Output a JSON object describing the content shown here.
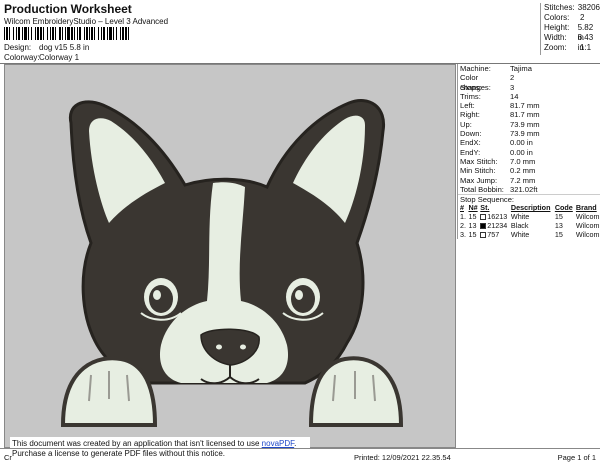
{
  "header": {
    "title": "Production Worksheet",
    "subtitle": "Wilcom EmbroideryStudio – Level 3 Advanced",
    "design_label": "Design:",
    "design_value": "dog v15 5.8 in",
    "colorway_label": "Colorway:",
    "colorway_value": "Colorway 1"
  },
  "summary": [
    {
      "label": "Stitches:",
      "value": "38206"
    },
    {
      "label": "Colors:",
      "value": "2"
    },
    {
      "label": "Height:",
      "value": "5.82 in"
    },
    {
      "label": "Width:",
      "value": "6.43 in"
    },
    {
      "label": "Zoom:",
      "value": "1:1"
    }
  ],
  "machine_info": [
    {
      "label": "Machine:",
      "value": "Tajima"
    },
    {
      "label": "Color changes:",
      "value": "2"
    },
    {
      "label": "Stops:",
      "value": "3"
    },
    {
      "label": "Trims:",
      "value": "14"
    },
    {
      "label": "Left:",
      "value": "81.7 mm"
    },
    {
      "label": "Right:",
      "value": "81.7 mm"
    },
    {
      "label": "Up:",
      "value": "73.9 mm"
    },
    {
      "label": "Down:",
      "value": "73.9 mm"
    },
    {
      "label": "EndX:",
      "value": "0.00 in"
    },
    {
      "label": "EndY:",
      "value": "0.00 in"
    },
    {
      "label": "Max Stitch:",
      "value": "7.0 mm"
    },
    {
      "label": "Min Stitch:",
      "value": "0.2 mm"
    },
    {
      "label": "Max Jump:",
      "value": "7.2 mm"
    },
    {
      "label": "Total Bobbin:",
      "value": "321.02ft"
    }
  ],
  "stop_sequence": {
    "title": "Stop Sequence:",
    "headers": [
      "#",
      "N#",
      "St.",
      "Description",
      "Code",
      "Brand"
    ],
    "rows": [
      {
        "num": "1.",
        "n": "15",
        "st": "16213",
        "desc": "White",
        "code": "15",
        "brand": "Wilcom",
        "swatch": "#ffffff"
      },
      {
        "num": "2.",
        "n": "13",
        "st": "21234",
        "desc": "Black",
        "code": "13",
        "brand": "Wilcom",
        "swatch": "#000000"
      },
      {
        "num": "3.",
        "n": "15",
        "st": "757",
        "desc": "White",
        "code": "15",
        "brand": "Wilcom",
        "swatch": "#ffffff"
      }
    ]
  },
  "notice": {
    "line1": "This document was created by an application that isn't licensed to use ",
    "link": "novaPDF",
    "line1_end": ".",
    "line2": "Purchase a license to generate PDF files without this notice."
  },
  "footer": {
    "left": "Cr",
    "printed": "Printed: 12/09/2021 22.35.54",
    "page": "Page 1 of 1"
  },
  "colors": {
    "canvas_bg": "#c6c6c6",
    "dark_thread": "#3a3631",
    "light_thread": "#e7eee2",
    "outline": "#26231f"
  }
}
